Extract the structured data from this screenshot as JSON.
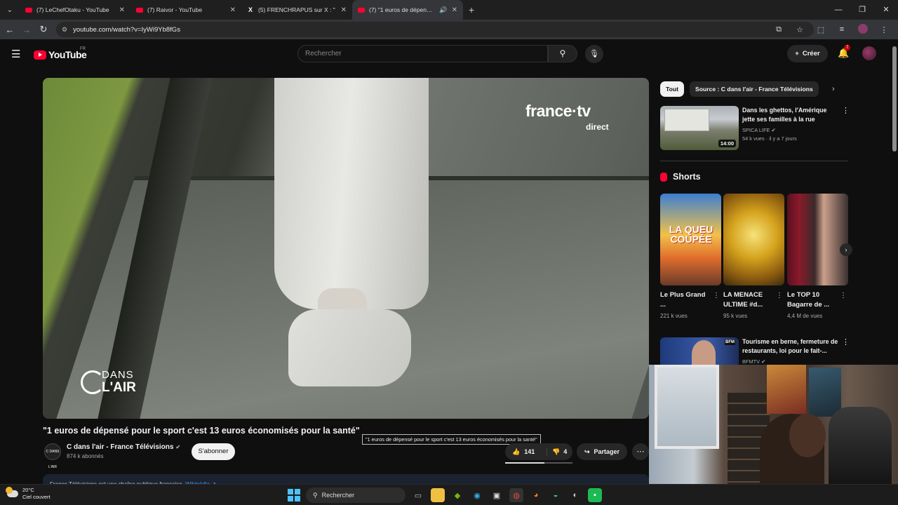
{
  "browser": {
    "tabs": [
      {
        "title": "(7) LeChefOtaku - YouTube",
        "favicon": "youtube-icon",
        "active": false
      },
      {
        "title": "(7) Raivor - YouTube",
        "favicon": "youtube-icon",
        "active": false
      },
      {
        "title": "(5) FRENCHRAPUS sur X : \"",
        "favicon": "x-icon",
        "active": false
      },
      {
        "title": "(7) \"1 euros de dépensé po",
        "favicon": "youtube-icon",
        "active": true
      }
    ],
    "url": "youtube.com/watch?v=IyWi9Yb8fGs"
  },
  "youtube": {
    "logo_text": "YouTube",
    "country_code": "FR",
    "search_placeholder": "Rechercher",
    "create_label": "Créer",
    "notification_count": "7"
  },
  "video": {
    "overlay_brand": "france·tv",
    "overlay_brand_sub": "direct",
    "overlay_show_line1": "DANS",
    "overlay_show_line2": "L'AIR",
    "title": "\"1 euros de dépensé pour le sport c'est 13 euros économisés pour la santé\"",
    "tooltip": "\"1 euros de dépensé pour le sport c'est 13 euros économisés pour la santé\"",
    "channel_name": "C dans l'air - France Télévisions",
    "channel_avatar_text": "C DANS L'AIR",
    "subscribers": "874 k abonnés",
    "subscribe_label": "S'abonner",
    "likes": "141",
    "dislikes": "4",
    "like_ratio": 0.58,
    "share_label": "Partager",
    "info_text": "France Télévisions est une chaîne publique française.",
    "info_link": "Wikipédia ↗"
  },
  "sidebar": {
    "chips": [
      "Tout",
      "Source : C dans l'air - France Télévisions"
    ],
    "recommendations": [
      {
        "title": "Dans les ghettos, l'Amérique jette ses familles à la rue",
        "channel": "SPICA LIFE",
        "meta": "54 k vues · il y a 7 jours",
        "duration": "14:00"
      },
      {
        "title": "Tourisme en berne, fermeture de restaurants, loi pour le fait-...",
        "channel": "BFMTV",
        "meta": "",
        "duration": ""
      }
    ],
    "shorts_heading": "Shorts",
    "shorts": [
      {
        "title": "Le Plus Grand ...",
        "views": "221 k vues",
        "thumb_text": "LA QUEU COUPÉE"
      },
      {
        "title": "LA MENACE ULTIME #d...",
        "views": "95 k vues",
        "thumb_text": ""
      },
      {
        "title": "Le TOP 10 Bagarre de ...",
        "views": "4,4 M de vues",
        "thumb_text": ""
      }
    ]
  },
  "taskbar": {
    "temperature": "20°C",
    "weather": "Ciel couvert",
    "search_label": "Rechercher"
  }
}
